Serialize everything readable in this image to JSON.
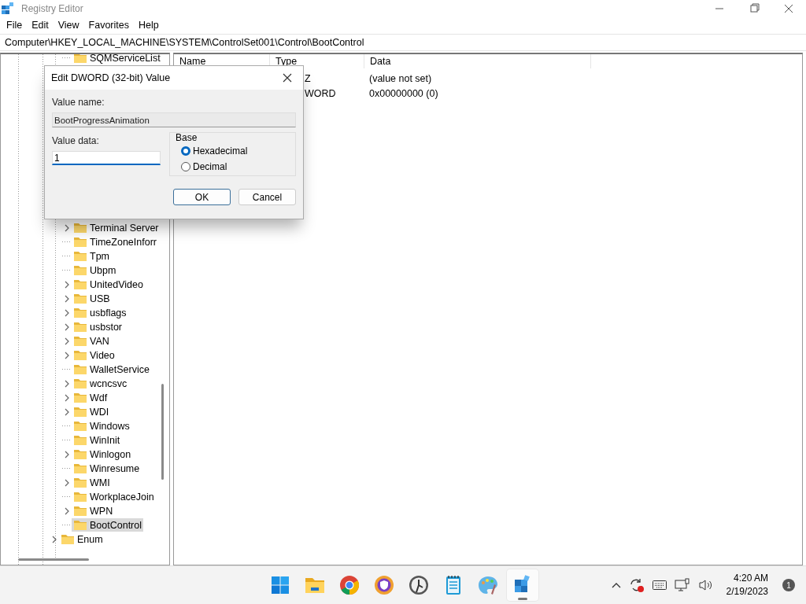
{
  "window": {
    "title": "Registry Editor"
  },
  "menu": [
    "File",
    "Edit",
    "View",
    "Favorites",
    "Help"
  ],
  "address": "Computer\\HKEY_LOCAL_MACHINE\\SYSTEM\\ControlSet001\\Control\\BootControl",
  "tree": {
    "nodes": [
      {
        "children": [
          {
            "label": "SQMServiceList",
            "expandable": false,
            "selected": false
          },
          {
            "label": "Terminal Server",
            "expandable": true,
            "selected": false
          },
          {
            "label": "TimeZoneInforr",
            "expandable": false,
            "selected": false
          },
          {
            "label": "Tpm",
            "expandable": false,
            "selected": false
          },
          {
            "label": "Ubpm",
            "expandable": false,
            "selected": false
          },
          {
            "label": "UnitedVideo",
            "expandable": true,
            "selected": false
          },
          {
            "label": "USB",
            "expandable": true,
            "selected": false
          },
          {
            "label": "usbflags",
            "expandable": true,
            "selected": false
          },
          {
            "label": "usbstor",
            "expandable": true,
            "selected": false
          },
          {
            "label": "VAN",
            "expandable": true,
            "selected": false
          },
          {
            "label": "Video",
            "expandable": true,
            "selected": false
          },
          {
            "label": "WalletService",
            "expandable": false,
            "selected": false
          },
          {
            "label": "wcncsvc",
            "expandable": true,
            "selected": false
          },
          {
            "label": "Wdf",
            "expandable": true,
            "selected": false
          },
          {
            "label": "WDI",
            "expandable": true,
            "selected": false
          },
          {
            "label": "Windows",
            "expandable": false,
            "selected": false
          },
          {
            "label": "WinInit",
            "expandable": false,
            "selected": false
          },
          {
            "label": "Winlogon",
            "expandable": true,
            "selected": false
          },
          {
            "label": "Winresume",
            "expandable": false,
            "selected": false
          },
          {
            "label": "WMI",
            "expandable": true,
            "selected": false
          },
          {
            "label": "WorkplaceJoin",
            "expandable": false,
            "selected": false
          },
          {
            "label": "WPN",
            "expandable": true,
            "selected": false
          },
          {
            "label": "BootControl",
            "expandable": false,
            "selected": true
          }
        ]
      },
      {
        "label": "Enum",
        "expandable": true,
        "selected": false
      }
    ]
  },
  "list": {
    "columns": [
      "Name",
      "Type",
      "Data"
    ],
    "rows": [
      {
        "type": "Z",
        "data": "(value not set)"
      },
      {
        "type": "WORD",
        "data": "0x00000000 (0)"
      }
    ]
  },
  "dialog": {
    "title": "Edit DWORD (32-bit) Value",
    "value_name_label": "Value name:",
    "value_name": "BootProgressAnimation",
    "value_data_label": "Value data:",
    "value_data": "1",
    "base": {
      "label": "Base",
      "options": [
        {
          "label": "Hexadecimal",
          "selected": true
        },
        {
          "label": "Decimal",
          "selected": false
        }
      ]
    },
    "buttons": [
      {
        "label": "OK",
        "default": true
      },
      {
        "label": "Cancel",
        "default": false
      }
    ]
  },
  "taskbar": {
    "apps": [
      {
        "kind": "start",
        "active": false
      },
      {
        "kind": "folder",
        "active": false
      },
      {
        "kind": "chrome",
        "active": false
      },
      {
        "kind": "shield",
        "active": false
      },
      {
        "kind": "clock",
        "active": false
      },
      {
        "kind": "notepad",
        "active": false
      },
      {
        "kind": "palette",
        "active": false
      },
      {
        "kind": "regedit",
        "active": true
      }
    ],
    "time": "4:20 AM",
    "date": "2/19/2023",
    "notification_count": "1"
  }
}
